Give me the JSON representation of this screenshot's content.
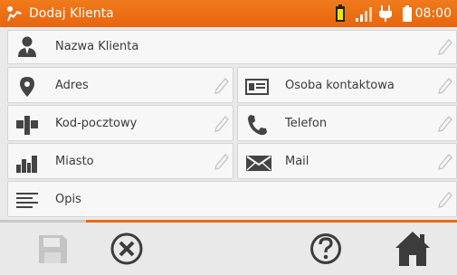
{
  "header": {
    "title": "Dodaj Klienta",
    "clock": "08:00"
  },
  "fields": {
    "client_name": "Nazwa Klienta",
    "address": "Adres",
    "contact_person": "Osoba kontaktowa",
    "postal_code": "Kod-pocztowy",
    "phone": "Telefon",
    "city": "Miasto",
    "mail": "Mail",
    "description": "Opis"
  },
  "colors": {
    "accent": "#ec6a10",
    "icon_dark": "#444444",
    "icon_light": "#bdbdbd"
  },
  "icons": {
    "app": "person-walk-icon",
    "battery_device": "battery-icon",
    "signal": "signal-icon",
    "power": "plug-icon",
    "battery_status": "battery-status-icon",
    "save": "save-icon",
    "cancel": "cancel-icon",
    "help": "help-icon",
    "home": "home-icon",
    "edit": "pencil-icon"
  }
}
